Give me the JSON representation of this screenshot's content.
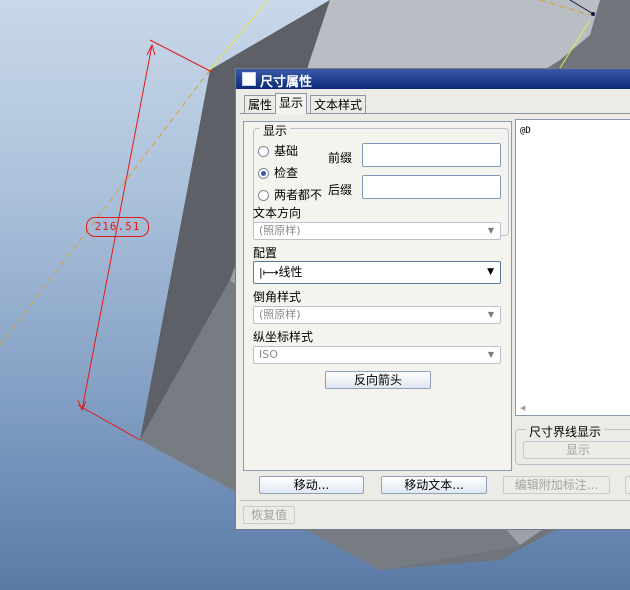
{
  "viewport": {
    "dimension_value": "216.51",
    "line_color": "#e21a1a",
    "accent_color": "#f0f020"
  },
  "dialog": {
    "title": "尺寸属性",
    "tabs": [
      "属性",
      "显示",
      "文本样式"
    ],
    "active_tab": "显示",
    "display_group": {
      "legend": "显示",
      "options": [
        "基础",
        "检查",
        "两者都不"
      ],
      "selected": "检查",
      "prefix_label": "前缀",
      "prefix_value": "",
      "suffix_label": "后缀",
      "suffix_value": ""
    },
    "text_orientation": {
      "label": "文本方向",
      "value": "(照原样)"
    },
    "config": {
      "label": "配置",
      "value": "线性",
      "icon": "linear-dimension-icon"
    },
    "chamfer_style": {
      "label": "倒角样式",
      "value": "(照原样)"
    },
    "ordinate_style": {
      "label": "纵坐标样式",
      "value": "ISO"
    },
    "flip_arrows_label": "反向箭头",
    "preview_text": "@D",
    "witness_line": {
      "legend": "尺寸界线显示",
      "button": "显示"
    },
    "bottom_buttons": {
      "move": "移动...",
      "move_text": "移动文本...",
      "edit_attach": "编辑附加标注..."
    },
    "restore_label": "恢复值"
  }
}
